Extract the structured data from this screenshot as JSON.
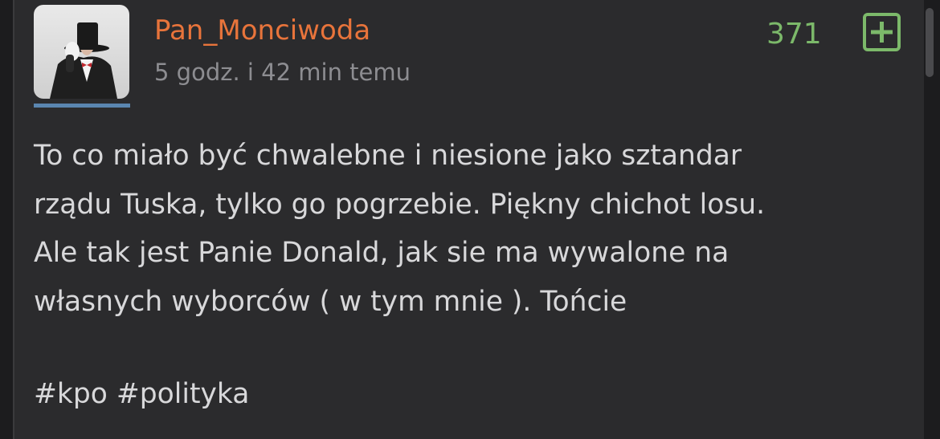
{
  "post": {
    "author": "Pan_Monciwoda",
    "time_ago": "5 godz. i 42 min temu",
    "score": "371",
    "body": "To co miało być chwalebne i niesione jako sztandar\nrządu Tuska, tylko go pogrzebie. Piękny chichot losu.\nAle tak jest Panie Donald, jak sie ma wywalone na\nwłasnych wyborców ( w tym mnie ). Tońcie",
    "tags": "#kpo #polityka"
  },
  "colors": {
    "author": "#e8743b",
    "score": "#7cb96a",
    "background": "#2b2b2d",
    "text": "#d8d8da"
  },
  "icons": {
    "vote": "plus-icon",
    "avatar": "top-hat-avatar"
  }
}
